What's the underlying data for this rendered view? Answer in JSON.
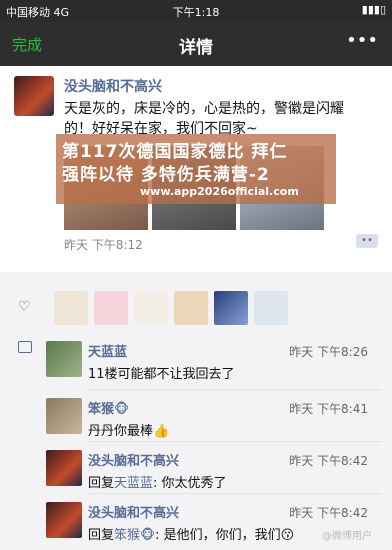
{
  "status": {
    "carrier": "中国移动",
    "network": "4G",
    "time": "下午1:18"
  },
  "nav": {
    "done": "完成",
    "title": "详情",
    "more": "•••"
  },
  "post": {
    "author": "没头脑和不高兴",
    "text": "天是灰的，床是冷的，心是热的，警徽是闪耀的！好好呆在家，我们不回家~",
    "time": "昨天 下午8:12",
    "comment_button": "••"
  },
  "watermark": {
    "line1": "第117次德国国家德比 拜仁",
    "line2": "强阵以待 多特伤兵满营-2",
    "url": "www.app2026official.com"
  },
  "comments": [
    {
      "name": "天蓝蓝",
      "time": "昨天 下午8:26",
      "text": "11楼可能都不让我回去了"
    },
    {
      "name": "笨猴🐵",
      "time": "昨天 下午8:41",
      "text": "丹丹你最棒👍"
    },
    {
      "name": "没头脑和不高兴",
      "time": "昨天 下午8:42",
      "reply_prefix": "回复",
      "reply_to": "天蓝蓝",
      "text": ": 你太优秀了"
    },
    {
      "name": "没头脑和不高兴",
      "time": "昨天 下午8:42",
      "reply_prefix": "回复",
      "reply_to": "笨猴🐵",
      "text": ": 是他们，你们，我们😗"
    }
  ],
  "weibo_mark": "@微博用户"
}
